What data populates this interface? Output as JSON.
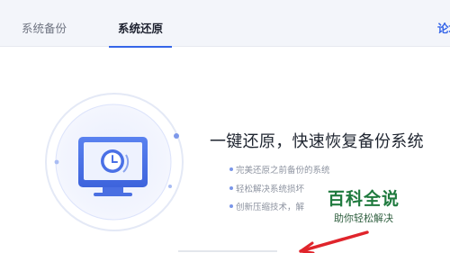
{
  "tabs": {
    "backup_label": "系统备份",
    "restore_label": "系统还原",
    "forum_label": "论坛"
  },
  "main": {
    "headline": "一键还原，快速恢复备份系统",
    "features": [
      "完美还原之前备份的系统",
      "轻松解决系统损坏",
      "创新压缩技术，解"
    ]
  },
  "watermark": {
    "title": "百科全说",
    "subtitle": "助你轻松解决"
  },
  "colors": {
    "accent": "#3565e8",
    "tab_background": "#f3f5fa",
    "arrow": "#e0242b",
    "watermark_green": "#1f7a3e"
  },
  "icons": [
    "monitor-clock-icon",
    "restore-arrow-icon"
  ]
}
